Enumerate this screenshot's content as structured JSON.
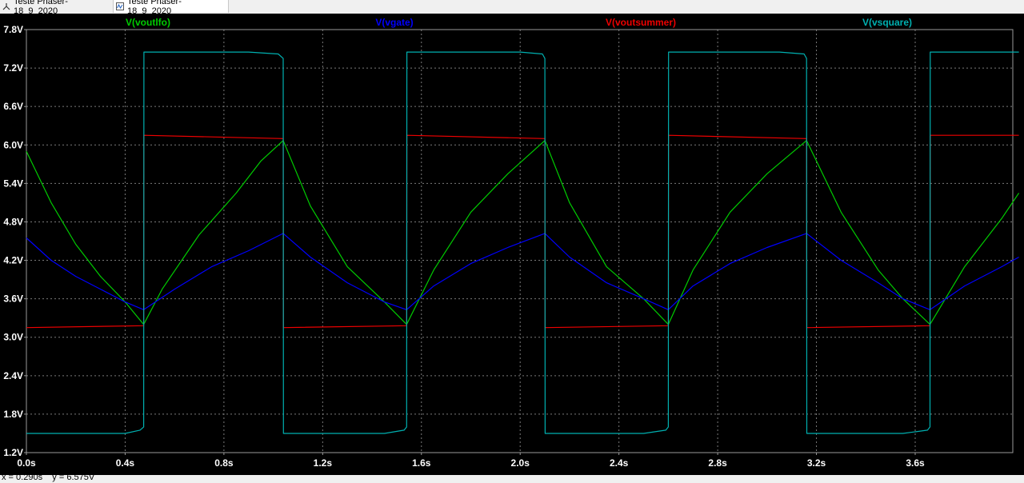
{
  "tabs": [
    {
      "label": "Teste Phaser-18_9_2020",
      "icon": "schematic-icon",
      "active": false
    },
    {
      "label": "Teste Phaser-18_9_2020",
      "icon": "waveform-icon",
      "active": true
    }
  ],
  "status": {
    "text": "x = 0.290s    y = 6.575V"
  },
  "colors": {
    "background": "#000000",
    "grid": "#7a7a7a",
    "axis_labels": "#ffffff",
    "voutlfo": "#00cc00",
    "vgate": "#0000ff",
    "voutsummer": "#ee0000",
    "vsquare": "#00b0b0"
  },
  "chart_data": {
    "type": "line",
    "title": "",
    "xlabel": "",
    "ylabel": "",
    "x_unit": "s",
    "y_unit": "V",
    "xlim": [
      0.0,
      4.0
    ],
    "ylim": [
      1.2,
      7.8
    ],
    "grid": true,
    "legend_placement": "top",
    "xticks": [
      0.0,
      0.4,
      0.8,
      1.2,
      1.6,
      2.0,
      2.4,
      2.8,
      3.2,
      3.6
    ],
    "xtick_labels": [
      "0.0s",
      "0.4s",
      "0.8s",
      "1.2s",
      "1.6s",
      "2.0s",
      "2.4s",
      "2.8s",
      "3.2s",
      "3.6s"
    ],
    "yticks": [
      1.2,
      1.8,
      2.4,
      3.0,
      3.6,
      4.2,
      4.8,
      5.4,
      6.0,
      6.6,
      7.2,
      7.8
    ],
    "ytick_labels": [
      "1.2V",
      "1.8V",
      "2.4V",
      "3.0V",
      "3.6V",
      "4.2V",
      "4.8V",
      "5.4V",
      "6.0V",
      "6.6V",
      "7.2V",
      "7.8V"
    ],
    "series": [
      {
        "name": "V(voutlfo)",
        "color": "#00cc00",
        "points": [
          [
            0.0,
            5.9
          ],
          [
            0.1,
            5.1
          ],
          [
            0.2,
            4.45
          ],
          [
            0.3,
            3.95
          ],
          [
            0.4,
            3.55
          ],
          [
            0.475,
            3.2
          ],
          [
            0.55,
            3.75
          ],
          [
            0.7,
            4.6
          ],
          [
            0.85,
            5.25
          ],
          [
            0.95,
            5.75
          ],
          [
            1.04,
            6.07
          ],
          [
            1.15,
            5.05
          ],
          [
            1.3,
            4.1
          ],
          [
            1.45,
            3.55
          ],
          [
            1.54,
            3.2
          ],
          [
            1.65,
            4.05
          ],
          [
            1.8,
            4.95
          ],
          [
            1.95,
            5.55
          ],
          [
            2.1,
            6.07
          ],
          [
            2.2,
            5.1
          ],
          [
            2.35,
            4.1
          ],
          [
            2.5,
            3.6
          ],
          [
            2.6,
            3.2
          ],
          [
            2.7,
            4.05
          ],
          [
            2.85,
            4.95
          ],
          [
            3.0,
            5.55
          ],
          [
            3.16,
            6.07
          ],
          [
            3.3,
            4.95
          ],
          [
            3.45,
            4.05
          ],
          [
            3.55,
            3.6
          ],
          [
            3.66,
            3.2
          ],
          [
            3.8,
            4.1
          ],
          [
            3.95,
            4.85
          ],
          [
            4.02,
            5.25
          ]
        ]
      },
      {
        "name": "V(vgate)",
        "color": "#0000ff",
        "points": [
          [
            0.0,
            4.55
          ],
          [
            0.1,
            4.2
          ],
          [
            0.2,
            3.95
          ],
          [
            0.3,
            3.75
          ],
          [
            0.4,
            3.55
          ],
          [
            0.475,
            3.43
          ],
          [
            0.6,
            3.75
          ],
          [
            0.75,
            4.1
          ],
          [
            0.9,
            4.35
          ],
          [
            1.04,
            4.62
          ],
          [
            1.15,
            4.25
          ],
          [
            1.3,
            3.85
          ],
          [
            1.45,
            3.55
          ],
          [
            1.54,
            3.43
          ],
          [
            1.65,
            3.8
          ],
          [
            1.8,
            4.15
          ],
          [
            1.95,
            4.4
          ],
          [
            2.1,
            4.62
          ],
          [
            2.2,
            4.25
          ],
          [
            2.35,
            3.85
          ],
          [
            2.5,
            3.6
          ],
          [
            2.6,
            3.43
          ],
          [
            2.7,
            3.8
          ],
          [
            2.85,
            4.15
          ],
          [
            3.0,
            4.4
          ],
          [
            3.16,
            4.62
          ],
          [
            3.3,
            4.2
          ],
          [
            3.45,
            3.85
          ],
          [
            3.55,
            3.6
          ],
          [
            3.66,
            3.43
          ],
          [
            3.8,
            3.8
          ],
          [
            3.95,
            4.1
          ],
          [
            4.02,
            4.25
          ]
        ]
      },
      {
        "name": "V(voutsummer)",
        "color": "#ee0000",
        "points": [
          [
            0.0,
            3.15
          ],
          [
            0.475,
            3.18
          ],
          [
            0.476,
            6.15
          ],
          [
            1.04,
            6.1
          ],
          [
            1.041,
            3.15
          ],
          [
            1.54,
            3.18
          ],
          [
            1.541,
            6.15
          ],
          [
            2.1,
            6.1
          ],
          [
            2.1,
            5.8
          ],
          [
            2.101,
            3.15
          ],
          [
            2.6,
            3.18
          ],
          [
            2.601,
            6.15
          ],
          [
            3.16,
            6.1
          ],
          [
            3.161,
            3.15
          ],
          [
            3.66,
            3.18
          ],
          [
            3.661,
            6.15
          ],
          [
            4.02,
            6.15
          ]
        ]
      },
      {
        "name": "V(vsquare)",
        "color": "#00b0b0",
        "points": [
          [
            0.0,
            1.5
          ],
          [
            0.4,
            1.5
          ],
          [
            0.46,
            1.55
          ],
          [
            0.475,
            1.6
          ],
          [
            0.476,
            7.45
          ],
          [
            0.9,
            7.45
          ],
          [
            1.02,
            7.42
          ],
          [
            1.04,
            7.35
          ],
          [
            1.041,
            1.5
          ],
          [
            1.45,
            1.5
          ],
          [
            1.53,
            1.55
          ],
          [
            1.54,
            1.6
          ],
          [
            1.541,
            7.45
          ],
          [
            2.0,
            7.45
          ],
          [
            2.09,
            7.42
          ],
          [
            2.1,
            7.35
          ],
          [
            2.101,
            1.5
          ],
          [
            2.5,
            1.5
          ],
          [
            2.59,
            1.55
          ],
          [
            2.6,
            1.6
          ],
          [
            2.601,
            7.45
          ],
          [
            3.05,
            7.45
          ],
          [
            3.15,
            7.42
          ],
          [
            3.16,
            7.35
          ],
          [
            3.161,
            1.5
          ],
          [
            3.55,
            1.5
          ],
          [
            3.65,
            1.55
          ],
          [
            3.66,
            1.6
          ],
          [
            3.661,
            7.45
          ],
          [
            4.02,
            7.45
          ]
        ]
      }
    ]
  }
}
